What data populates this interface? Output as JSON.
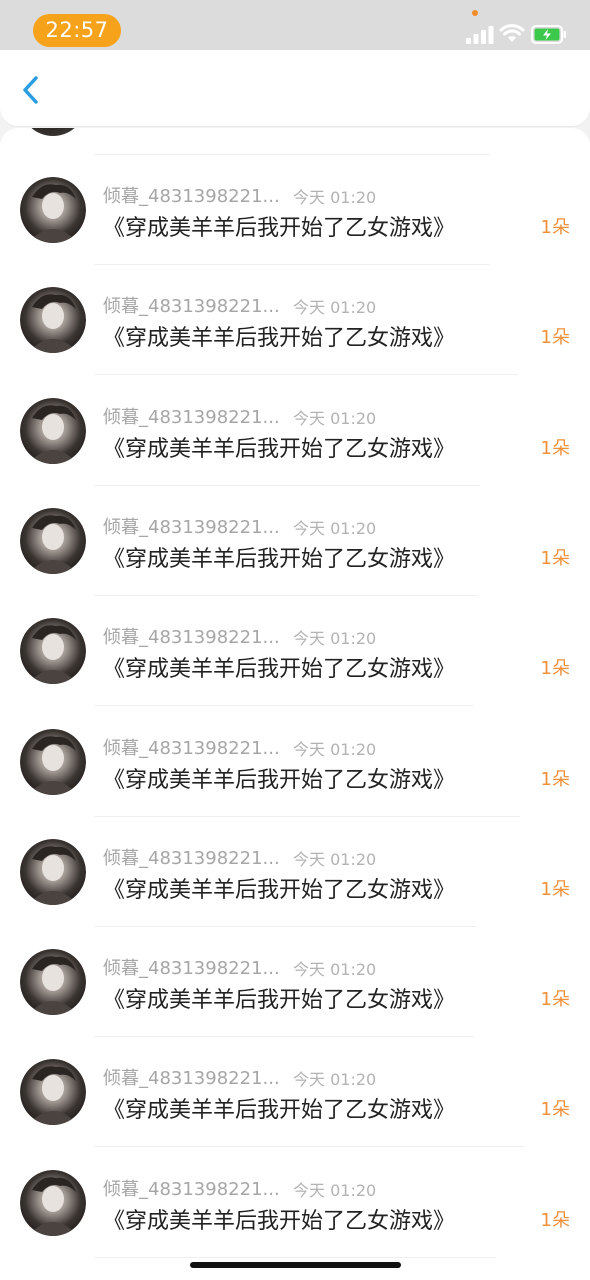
{
  "status_bar": {
    "time": "22:57",
    "icons": [
      "signal-icon",
      "wifi-icon",
      "battery-charging-icon"
    ],
    "accent_color": "#f7a21b"
  },
  "header": {
    "back_icon": "chevron-left-icon",
    "back_color": "#2a9de0"
  },
  "items": [
    {
      "username": "倾暮_4831398221...",
      "time": "今天 01:20",
      "title": "《穿成美羊羊后我开始了乙女游戏》",
      "count": "1朵"
    },
    {
      "username": "倾暮_4831398221...",
      "time": "今天 01:20",
      "title": "《穿成美羊羊后我开始了乙女游戏》",
      "count": "1朵"
    },
    {
      "username": "倾暮_4831398221...",
      "time": "今天 01:20",
      "title": "《穿成美羊羊后我开始了乙女游戏》",
      "count": "1朵"
    },
    {
      "username": "倾暮_4831398221...",
      "time": "今天 01:20",
      "title": "《穿成美羊羊后我开始了乙女游戏》",
      "count": "1朵"
    },
    {
      "username": "倾暮_4831398221...",
      "time": "今天 01:20",
      "title": "《穿成美羊羊后我开始了乙女游戏》",
      "count": "1朵"
    },
    {
      "username": "倾暮_4831398221...",
      "time": "今天 01:20",
      "title": "《穿成美羊羊后我开始了乙女游戏》",
      "count": "1朵"
    },
    {
      "username": "倾暮_4831398221...",
      "time": "今天 01:20",
      "title": "《穿成美羊羊后我开始了乙女游戏》",
      "count": "1朵"
    },
    {
      "username": "倾暮_4831398221...",
      "time": "今天 01:20",
      "title": "《穿成美羊羊后我开始了乙女游戏》",
      "count": "1朵"
    },
    {
      "username": "倾暮_4831398221...",
      "time": "今天 01:20",
      "title": "《穿成美羊羊后我开始了乙女游戏》",
      "count": "1朵"
    },
    {
      "username": "倾暮_4831398221...",
      "time": "今天 01:20",
      "title": "《穿成美羊羊后我开始了乙女游戏》",
      "count": "1朵"
    }
  ],
  "colors": {
    "count": "#f0913a",
    "username": "#a6a6a6",
    "title": "#222222"
  }
}
